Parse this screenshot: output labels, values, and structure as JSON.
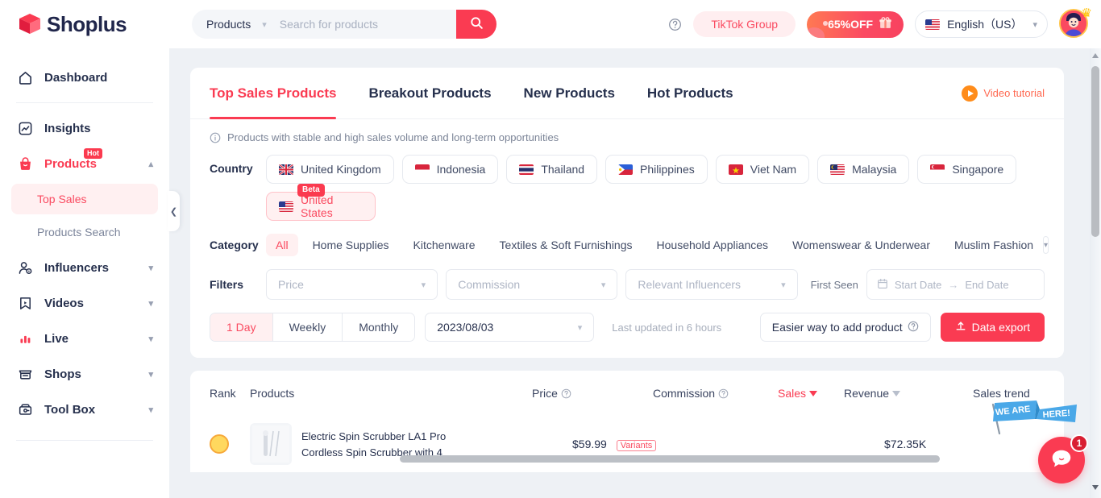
{
  "brand": {
    "name": "Shoplus"
  },
  "search": {
    "category_label": "Products",
    "placeholder": "Search for products",
    "value": ""
  },
  "header": {
    "help_icon": "question-circle-icon",
    "tiktok_group_label": "TikTok Group",
    "promo_label": "65%OFF",
    "promo_icon": "gift-icon",
    "language_label": "English（US）",
    "language_flag": "us-flag-icon",
    "avatar_icon": "user-avatar-crown-icon"
  },
  "sidebar": {
    "items": [
      {
        "label": "Dashboard",
        "icon": "home-icon",
        "expandable": false,
        "active": false
      },
      {
        "label": "Insights",
        "icon": "chart-insights-icon",
        "expandable": false,
        "active": false
      },
      {
        "label": "Products",
        "icon": "bag-icon",
        "expandable": true,
        "active": true,
        "badge": "Hot"
      },
      {
        "label": "Influencers",
        "icon": "user-gear-icon",
        "expandable": true,
        "active": false
      },
      {
        "label": "Videos",
        "icon": "video-bookmark-icon",
        "expandable": true,
        "active": false
      },
      {
        "label": "Live",
        "icon": "live-bars-icon",
        "expandable": true,
        "active": false
      },
      {
        "label": "Shops",
        "icon": "store-icon",
        "expandable": true,
        "active": false
      },
      {
        "label": "Tool Box",
        "icon": "toolbox-icon",
        "expandable": true,
        "active": false
      }
    ],
    "sub_items": [
      {
        "label": "Top Sales",
        "active": true
      },
      {
        "label": "Products Search",
        "active": false
      }
    ],
    "collapse_icon": "chevron-left-icon"
  },
  "main": {
    "tabs": [
      {
        "label": "Top Sales Products",
        "active": true
      },
      {
        "label": "Breakout Products",
        "active": false
      },
      {
        "label": "New Products",
        "active": false
      },
      {
        "label": "Hot Products",
        "active": false
      }
    ],
    "video_tutorial_label": "Video tutorial",
    "hint": "Products with stable and high sales volume and long-term opportunities",
    "country": {
      "label": "Country",
      "chips": [
        {
          "label": "United Kingdom",
          "flag": "gb-flag-icon",
          "selected": false
        },
        {
          "label": "Indonesia",
          "flag": "id-flag-icon",
          "selected": false
        },
        {
          "label": "Thailand",
          "flag": "th-flag-icon",
          "selected": false
        },
        {
          "label": "Philippines",
          "flag": "ph-flag-icon",
          "selected": false
        },
        {
          "label": "Viet Nam",
          "flag": "vn-flag-icon",
          "selected": false
        },
        {
          "label": "Malaysia",
          "flag": "my-flag-icon",
          "selected": false
        },
        {
          "label": "Singapore",
          "flag": "sg-flag-icon",
          "selected": false
        },
        {
          "label": "United States",
          "flag": "us-flag-icon",
          "selected": true,
          "badge": "Beta"
        }
      ]
    },
    "category": {
      "label": "Category",
      "items": [
        {
          "label": "All",
          "selected": true
        },
        {
          "label": "Home Supplies",
          "selected": false
        },
        {
          "label": "Kitchenware",
          "selected": false
        },
        {
          "label": "Textiles & Soft Furnishings",
          "selected": false
        },
        {
          "label": "Household Appliances",
          "selected": false
        },
        {
          "label": "Womenswear & Underwear",
          "selected": false
        },
        {
          "label": "Muslim Fashion",
          "selected": false
        }
      ],
      "more_icon": "chevron-down-icon"
    },
    "filters": {
      "label": "Filters",
      "price_placeholder": "Price",
      "commission_placeholder": "Commission",
      "influencers_placeholder": "Relevant Influencers",
      "first_seen_label": "First Seen",
      "start_date_placeholder": "Start Date",
      "end_date_placeholder": "End Date",
      "calendar_icon": "calendar-icon",
      "range_arrow": "→"
    },
    "period": {
      "segments": [
        {
          "label": "1 Day",
          "selected": true
        },
        {
          "label": "Weekly",
          "selected": false
        },
        {
          "label": "Monthly",
          "selected": false
        }
      ],
      "date_value": "2023/08/03",
      "last_updated": "Last updated in 6 hours",
      "add_product_label": "Easier way to add product",
      "add_product_help_icon": "question-circle-icon",
      "data_export_label": "Data export",
      "data_export_icon": "upload-icon"
    },
    "table": {
      "columns": [
        {
          "label": "Rank",
          "help": false,
          "sortable": false
        },
        {
          "label": "Products",
          "help": false,
          "sortable": false
        },
        {
          "label": "Price",
          "help": true,
          "sortable": false
        },
        {
          "label": "Commission",
          "help": true,
          "sortable": false
        },
        {
          "label": "Sales",
          "help": false,
          "sortable": true,
          "active": true
        },
        {
          "label": "Revenue",
          "help": false,
          "sortable": true,
          "active": false
        },
        {
          "label": "Sales trend",
          "help": false,
          "sortable": false
        }
      ],
      "rows": [
        {
          "rank": "1",
          "product_title_top": "Electric Spin Scrubber LA1 Pro",
          "product_title_bottom": "Cordless Spin Scrubber with 4",
          "price": "$59.99",
          "variants_tag": "Variants",
          "revenue": "$72.35K"
        }
      ]
    }
  },
  "chat": {
    "banner_left": "WE ARE",
    "banner_right": "HERE!",
    "badge_count": "1",
    "icon": "chat-bubble-icon"
  }
}
